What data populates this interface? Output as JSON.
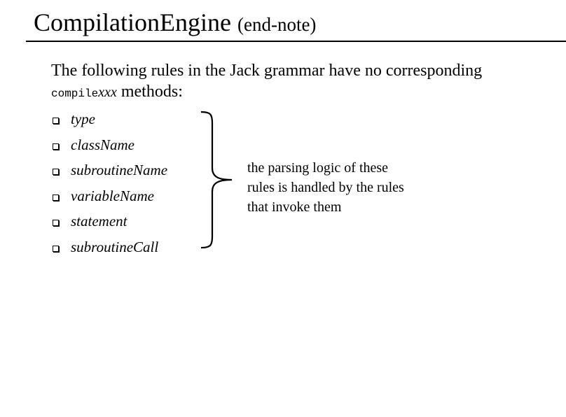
{
  "slide": {
    "title_main": "CompilationEngine",
    "title_sub": "(end-note)",
    "intro_text_1": "The following rules in the Jack grammar have no corresponding",
    "intro_code": "compile",
    "intro_code_italic": "xxx",
    "intro_text_2": " methods:",
    "rules": [
      {
        "label": "type"
      },
      {
        "label": "className"
      },
      {
        "label": "subroutineName"
      },
      {
        "label": "variableName"
      },
      {
        "label": "statement"
      },
      {
        "label": "subroutineCall"
      }
    ],
    "note_lines": [
      "the parsing logic of these",
      "rules is handled by the rules",
      "that invoke them"
    ],
    "bullet_icon": "square-bullet-icon",
    "brace_icon": "right-curly-brace-icon"
  }
}
